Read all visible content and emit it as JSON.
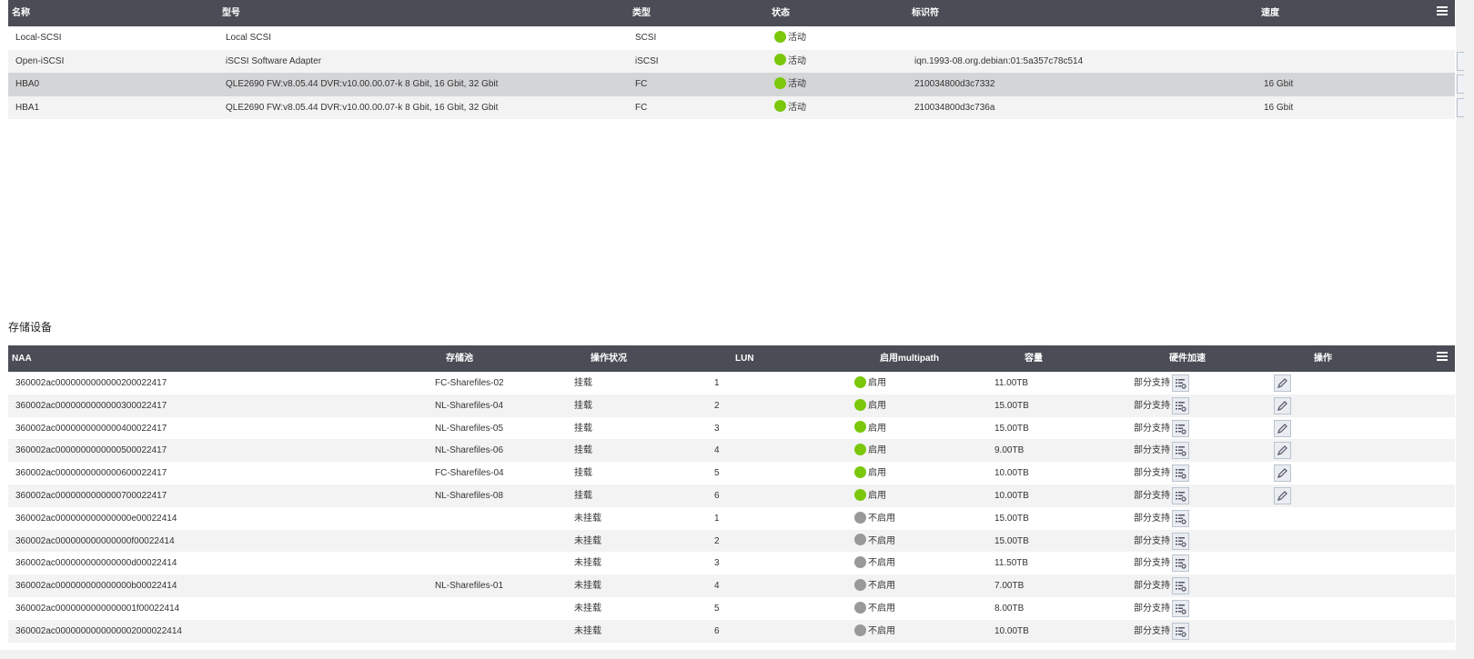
{
  "adapters": {
    "columns": [
      "名称",
      "型号",
      "类型",
      "状态",
      "标识符",
      "速度"
    ],
    "rows": [
      {
        "name": "Local-SCSI",
        "model": "Local SCSI",
        "type": "SCSI",
        "status": "活动",
        "id": "",
        "speed": ""
      },
      {
        "name": "Open-iSCSI",
        "model": "iSCSI Software Adapter",
        "type": "iSCSI",
        "status": "活动",
        "id": "iqn.1993-08.org.debian:01:5a357c78c514",
        "speed": ""
      },
      {
        "name": "HBA0",
        "model": "QLE2690 FW:v8.05.44 DVR:v10.00.00.07-k 8 Gbit, 16 Gbit, 32 Gbit",
        "type": "FC",
        "status": "活动",
        "id": "210034800d3c7332",
        "speed": "16 Gbit"
      },
      {
        "name": "HBA1",
        "model": "QLE2690 FW:v8.05.44 DVR:v10.00.00.07-k 8 Gbit, 16 Gbit, 32 Gbit",
        "type": "FC",
        "status": "活动",
        "id": "210034800d3c736a",
        "speed": "16 Gbit"
      }
    ]
  },
  "section_title": "存储设备",
  "devices": {
    "columns": [
      "NAA",
      "存储池",
      "操作状况",
      "LUN",
      "启用multipath",
      "容量",
      "硬件加速",
      "操作"
    ],
    "rows": [
      {
        "naa": "360002ac0000000000000200022417",
        "pool": "FC-Sharefiles-02",
        "state": "挂载",
        "lun": "1",
        "mp": "启用",
        "mp_on": true,
        "cap": "11.00TB",
        "hw": "部分支持",
        "editable": true
      },
      {
        "naa": "360002ac0000000000000300022417",
        "pool": "NL-Sharefiles-04",
        "state": "挂载",
        "lun": "2",
        "mp": "启用",
        "mp_on": true,
        "cap": "15.00TB",
        "hw": "部分支持",
        "editable": true
      },
      {
        "naa": "360002ac0000000000000400022417",
        "pool": "NL-Sharefiles-05",
        "state": "挂载",
        "lun": "3",
        "mp": "启用",
        "mp_on": true,
        "cap": "15.00TB",
        "hw": "部分支持",
        "editable": true
      },
      {
        "naa": "360002ac0000000000000500022417",
        "pool": "NL-Sharefiles-06",
        "state": "挂载",
        "lun": "4",
        "mp": "启用",
        "mp_on": true,
        "cap": "9.00TB",
        "hw": "部分支持",
        "editable": true
      },
      {
        "naa": "360002ac0000000000000600022417",
        "pool": "FC-Sharefiles-04",
        "state": "挂载",
        "lun": "5",
        "mp": "启用",
        "mp_on": true,
        "cap": "10.00TB",
        "hw": "部分支持",
        "editable": true
      },
      {
        "naa": "360002ac0000000000000700022417",
        "pool": "NL-Sharefiles-08",
        "state": "挂载",
        "lun": "6",
        "mp": "启用",
        "mp_on": true,
        "cap": "10.00TB",
        "hw": "部分支持",
        "editable": true
      },
      {
        "naa": "360002ac000000000000000e00022414",
        "pool": "",
        "state": "未挂载",
        "lun": "1",
        "mp": "不启用",
        "mp_on": false,
        "cap": "15.00TB",
        "hw": "部分支持",
        "editable": false
      },
      {
        "naa": "360002ac000000000000000f00022414",
        "pool": "",
        "state": "未挂载",
        "lun": "2",
        "mp": "不启用",
        "mp_on": false,
        "cap": "15.00TB",
        "hw": "部分支持",
        "editable": false
      },
      {
        "naa": "360002ac000000000000000d00022414",
        "pool": "",
        "state": "未挂载",
        "lun": "3",
        "mp": "不启用",
        "mp_on": false,
        "cap": "11.50TB",
        "hw": "部分支持",
        "editable": false
      },
      {
        "naa": "360002ac000000000000000b00022414",
        "pool": "NL-Sharefiles-01",
        "state": "未挂载",
        "lun": "4",
        "mp": "不启用",
        "mp_on": false,
        "cap": "7.00TB",
        "hw": "部分支持",
        "editable": false
      },
      {
        "naa": "360002ac0000000000000001f00022414",
        "pool": "",
        "state": "未挂载",
        "lun": "5",
        "mp": "不启用",
        "mp_on": false,
        "cap": "8.00TB",
        "hw": "部分支持",
        "editable": false
      },
      {
        "naa": "360002ac0000000000000002000022414",
        "pool": "",
        "state": "未挂载",
        "lun": "6",
        "mp": "不启用",
        "mp_on": false,
        "cap": "10.00TB",
        "hw": "部分支持",
        "editable": false
      }
    ]
  },
  "colors": {
    "header_bg": "#4a4d55",
    "active": "#7ac70c",
    "inactive": "#999999"
  }
}
